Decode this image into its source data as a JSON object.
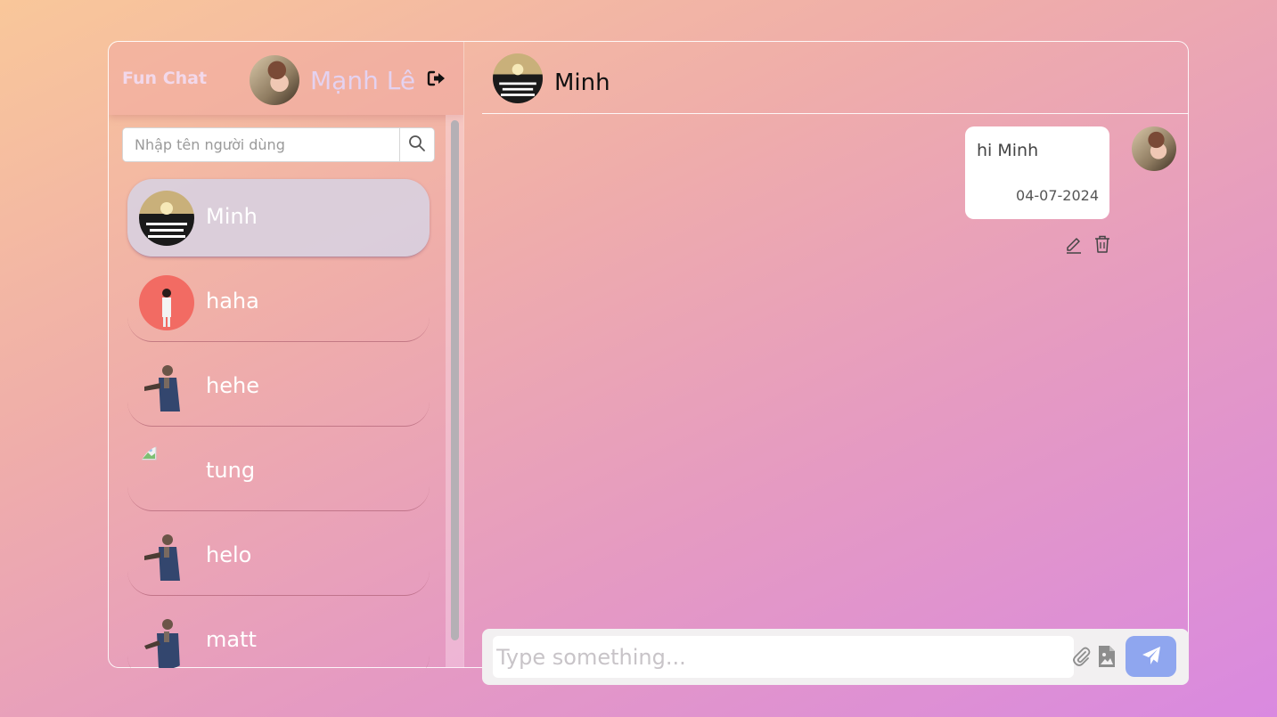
{
  "sidebar": {
    "brand": "Fun Chat",
    "current_user": "Mạnh Lê",
    "search_placeholder": "Nhập tên người dùng",
    "users": [
      {
        "name": "Minh",
        "active": true
      },
      {
        "name": "haha",
        "active": false
      },
      {
        "name": "hehe",
        "active": false
      },
      {
        "name": "tung",
        "active": false
      },
      {
        "name": "helo",
        "active": false
      },
      {
        "name": "matt",
        "active": false
      }
    ]
  },
  "chat": {
    "recipient": "Minh",
    "messages": [
      {
        "text": "hi Minh",
        "date": "04-07-2024"
      }
    ],
    "composer_placeholder": "Type something..."
  },
  "colors": {
    "send_button": "#8fa6ef",
    "active_item": "#d7d2e1",
    "brand_text": "#f2d8ea"
  }
}
